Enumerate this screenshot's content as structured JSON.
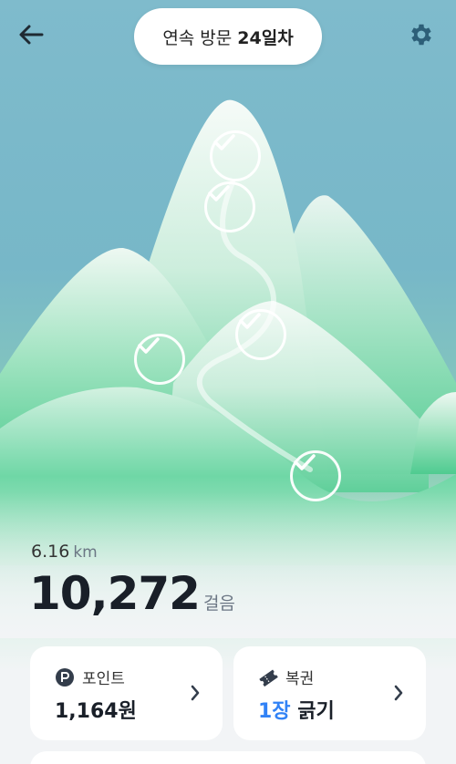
{
  "header": {
    "visit_prefix": "연속 방문",
    "visit_days": "24일차"
  },
  "stats": {
    "distance_value": "6.16",
    "distance_unit": "km",
    "steps_value": "10,272",
    "steps_unit": "걸음"
  },
  "cards": {
    "points": {
      "label": "포인트",
      "value": "1,164원",
      "icon": "point-p-icon"
    },
    "lottery": {
      "label": "복권",
      "count": "1장",
      "action": "긁기",
      "icon": "ticket-icon"
    }
  },
  "checkpoints_count": 5,
  "colors": {
    "sky": "#7fbbcc",
    "mountain_green": "#5fd3a0",
    "accent_blue": "#3182f6",
    "card_bg": "#ffffff"
  }
}
